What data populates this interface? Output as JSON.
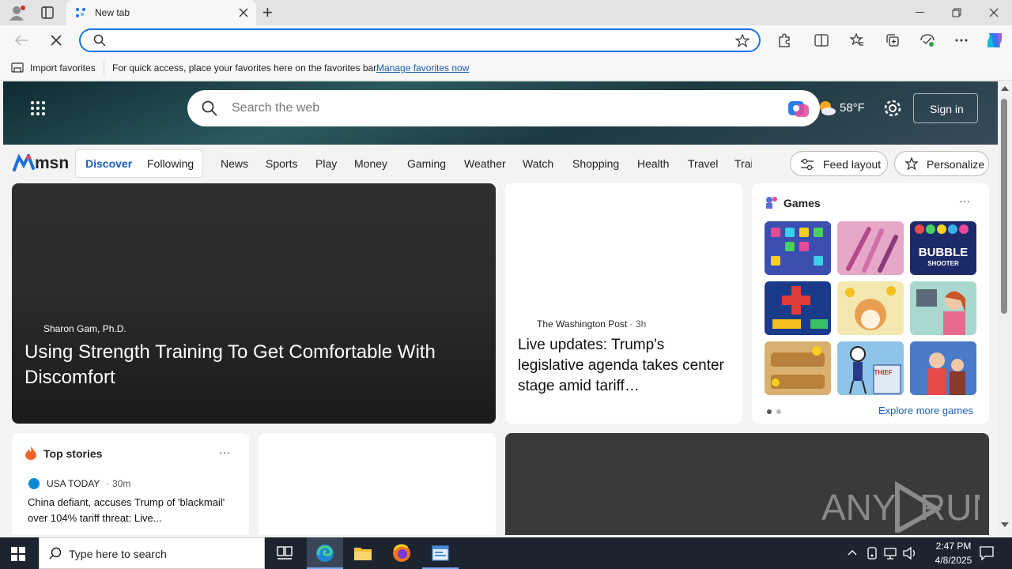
{
  "browser": {
    "tab_title": "New tab",
    "new_tab_symbol": "+",
    "address_value": "",
    "favorites_import": "Import favorites",
    "favorites_hint": "For quick access, place your favorites here on the favorites bar.",
    "favorites_manage": "Manage favorites now"
  },
  "msn": {
    "search_placeholder": "Search the web",
    "weather": "58°F",
    "sign_in": "Sign in",
    "logo": "msn",
    "tabs": [
      "Discover",
      "Following"
    ],
    "nav": [
      "News",
      "Sports",
      "Play",
      "Money",
      "Gaming",
      "Weather",
      "Watch",
      "Shopping",
      "Health",
      "Travel",
      "Trai"
    ],
    "feed_layout": "Feed layout",
    "personalize": "Personalize"
  },
  "hero_card": {
    "author": "Sharon Gam, Ph.D.",
    "headline": "Using Strength Training To Get Comfortable With Discomfort"
  },
  "news_card": {
    "source": "The Washington Post",
    "age": "3h",
    "headline": "Live updates: Trump's legislative agenda takes center stage amid tariff…"
  },
  "games": {
    "title": "Games",
    "more": "···",
    "explore": "Explore more games",
    "tiles": [
      {
        "name": "jewel-puzzle",
        "color": "#3a4fb0"
      },
      {
        "name": "makeup-brushes",
        "color": "#d88ab8"
      },
      {
        "name": "bubble-shooter",
        "color": "#1c2a6a",
        "label": "BUBBLE SHOOTER"
      },
      {
        "name": "block-puzzle",
        "color": "#1a3a8a"
      },
      {
        "name": "shiba-bees",
        "color": "#f2e8b0"
      },
      {
        "name": "hospital-girl",
        "color": "#a8d8d0"
      },
      {
        "name": "wood-nuts",
        "color": "#d9b070"
      },
      {
        "name": "thief-puzzle",
        "color": "#8ec4e8",
        "label": "THIEF"
      },
      {
        "name": "hotel-clerk",
        "color": "#4a7ac8"
      }
    ]
  },
  "top_stories": {
    "title": "Top stories",
    "more": "···",
    "source": "USA TODAY",
    "age": "30m",
    "headline": "China defiant, accuses Trump of 'blackmail' over 104% tariff threat: Live..."
  },
  "watermark": "ANY RUN",
  "taskbar": {
    "search_placeholder": "Type here to search",
    "time": "2:47 PM",
    "date": "4/8/2025"
  }
}
